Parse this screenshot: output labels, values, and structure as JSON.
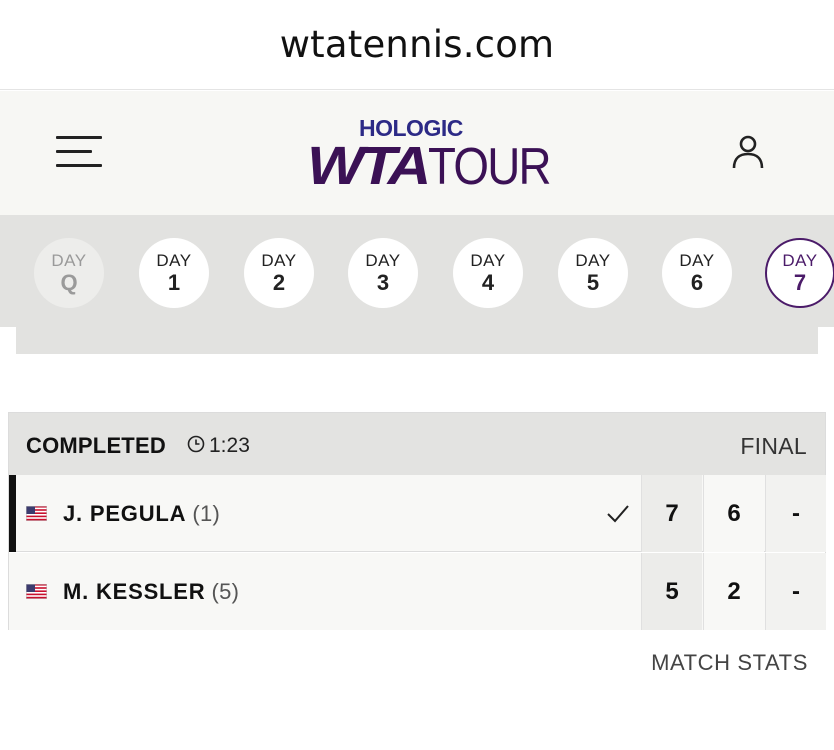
{
  "browser": {
    "url": "wtatennis.com"
  },
  "header": {
    "menu_icon": "hamburger-menu-icon",
    "logo": {
      "sponsor": "HOLOGIC",
      "brand": "WTA",
      "suffix": "TOUR"
    },
    "account_icon": "user-icon",
    "colors": {
      "sponsor": "#2c2a86",
      "brand": "#3b1155"
    }
  },
  "days": [
    {
      "label": "DAY",
      "value": "Q",
      "state": "disabled"
    },
    {
      "label": "DAY",
      "value": "1",
      "state": "normal"
    },
    {
      "label": "DAY",
      "value": "2",
      "state": "normal"
    },
    {
      "label": "DAY",
      "value": "3",
      "state": "normal"
    },
    {
      "label": "DAY",
      "value": "4",
      "state": "normal"
    },
    {
      "label": "DAY",
      "value": "5",
      "state": "normal"
    },
    {
      "label": "DAY",
      "value": "6",
      "state": "normal"
    },
    {
      "label": "DAY",
      "value": "7",
      "state": "active"
    }
  ],
  "match": {
    "status": "COMPLETED",
    "clock_icon": "clock-icon",
    "duration": "1:23",
    "result_label": "FINAL",
    "players": [
      {
        "name": "J. PEGULA",
        "seed": "(1)",
        "flag": "us-flag-icon",
        "winner": true,
        "scores": [
          "7",
          "6",
          "-"
        ]
      },
      {
        "name": "M. KESSLER",
        "seed": "(5)",
        "flag": "us-flag-icon",
        "winner": false,
        "scores": [
          "5",
          "2",
          "-"
        ]
      }
    ],
    "accent_color": "#4b1b69"
  },
  "footer": {
    "match_stats_label": "MATCH STATS"
  }
}
